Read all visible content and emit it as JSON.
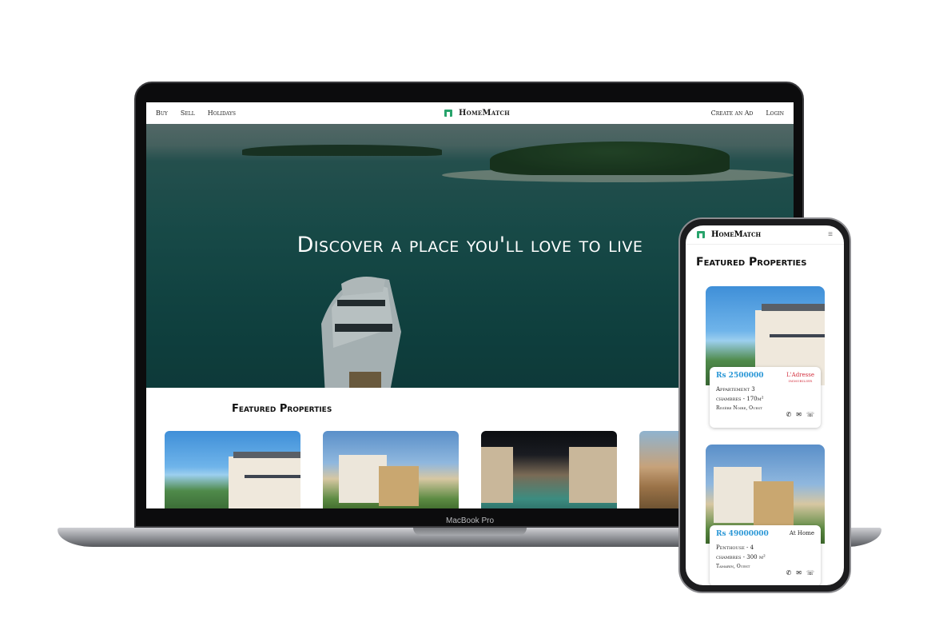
{
  "laptop": {
    "model_label": "MacBook Pro",
    "nav": {
      "left": [
        "Buy",
        "Sell",
        "Holidays"
      ],
      "brand": "HomeMatch",
      "right": [
        "Create an Ad",
        "Login"
      ]
    },
    "hero": {
      "title": "Discover a place you'll love to live"
    },
    "featured": {
      "title": "Featured Properties"
    }
  },
  "phone": {
    "brand": "HomeMatch",
    "menu_icon": "hamburger-icon",
    "title": "Featured Properties",
    "listings": [
      {
        "price": "Rs 2500000",
        "name_line1": "Appartement 3",
        "name_line2": "chambres - 170m²",
        "location": "Rivière Noire, Ouest",
        "agency": "L'Adresse",
        "agency_sub": "IMMOBILIER"
      },
      {
        "price": "Rs 49000000",
        "name_line1": "Penthouse - 4",
        "name_line2": "chambres - 300 m²",
        "location": "Tamarin, Ouest",
        "agency": "At Home",
        "agency_sub": ""
      }
    ],
    "contact_icons": [
      "phone-icon",
      "mail-icon",
      "whatsapp-icon"
    ]
  },
  "colors": {
    "accent": "#27a36b",
    "price": "#2a97d6",
    "agency": "#d3313f",
    "hero_sea": "#134a48"
  }
}
